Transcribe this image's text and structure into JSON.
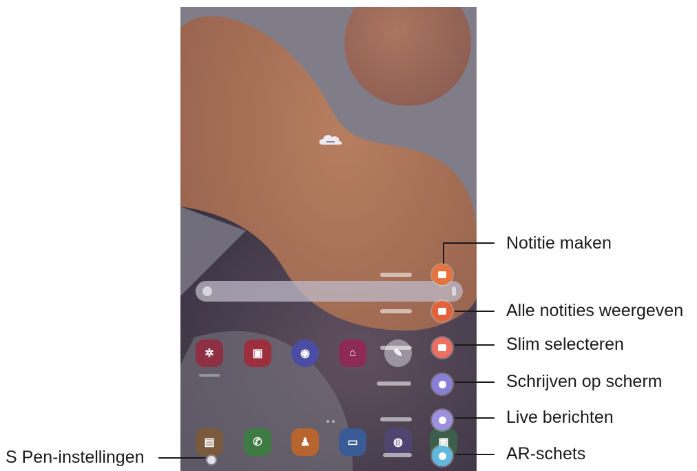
{
  "callouts": {
    "create_note": "Notitie maken",
    "view_all_notes": "Alle notities weergeven",
    "smart_select": "Slim selecteren",
    "screen_write": "Schrijven op scherm",
    "live_messages": "Live berichten",
    "ar_doodle": "AR-schets",
    "pen_settings": "S Pen-instellingen"
  },
  "air_command": {
    "items": [
      {
        "name": "create-note",
        "icon": "note-pencil-icon",
        "color": "#e4733d"
      },
      {
        "name": "view-all-notes",
        "icon": "notes-list-icon",
        "color": "#e4623a"
      },
      {
        "name": "smart-select",
        "icon": "smart-select-icon",
        "color": "#ee6e61"
      },
      {
        "name": "screen-write",
        "icon": "screen-write-icon",
        "color": "#8a7fd6"
      },
      {
        "name": "live-messages",
        "icon": "live-message-icon",
        "color": "#9b91df"
      },
      {
        "name": "ar-doodle",
        "icon": "ar-doodle-icon",
        "color": "#62b7dc"
      }
    ]
  },
  "colors": {
    "wallpaper_base": "#8f8a97",
    "wallpaper_orange": "#c98a5e",
    "wallpaper_dark": "#3e3a4a"
  }
}
